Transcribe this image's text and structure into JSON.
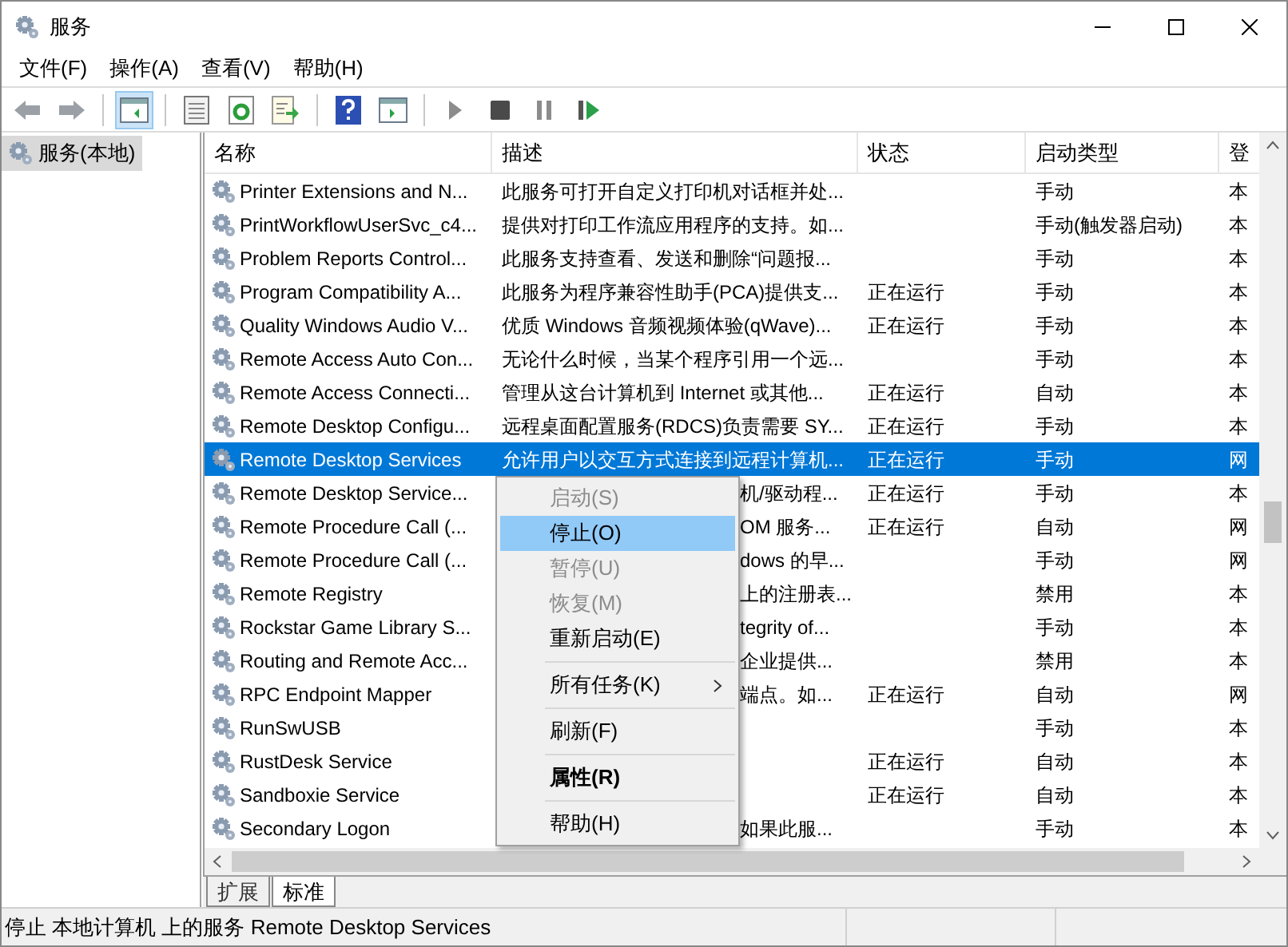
{
  "window": {
    "title": "服务"
  },
  "menubar": [
    "文件(F)",
    "操作(A)",
    "查看(V)",
    "帮助(H)"
  ],
  "tree": [
    {
      "label": "服务(本地)",
      "selected": true
    }
  ],
  "table": {
    "columns": [
      "名称",
      "描述",
      "状态",
      "启动类型",
      "登"
    ],
    "rows": [
      {
        "name": "Printer Extensions and N...",
        "description": "此服务可打开自定义打印机对话框并处...",
        "status": "",
        "startup": "手动",
        "logon": "本",
        "selected": false,
        "covered": false
      },
      {
        "name": "PrintWorkflowUserSvc_c4...",
        "description": "提供对打印工作流应用程序的支持。如...",
        "status": "",
        "startup": "手动(触发器启动)",
        "logon": "本",
        "selected": false,
        "covered": false
      },
      {
        "name": "Problem Reports Control...",
        "description": "此服务支持查看、发送和删除“问题报...",
        "status": "",
        "startup": "手动",
        "logon": "本",
        "selected": false,
        "covered": false
      },
      {
        "name": "Program Compatibility A...",
        "description": "此服务为程序兼容性助手(PCA)提供支...",
        "status": "正在运行",
        "startup": "手动",
        "logon": "本",
        "selected": false,
        "covered": false
      },
      {
        "name": "Quality Windows Audio V...",
        "description": "优质 Windows 音频视频体验(qWave)...",
        "status": "正在运行",
        "startup": "手动",
        "logon": "本",
        "selected": false,
        "covered": false
      },
      {
        "name": "Remote Access Auto Con...",
        "description": "无论什么时候，当某个程序引用一个远...",
        "status": "",
        "startup": "手动",
        "logon": "本",
        "selected": false,
        "covered": false
      },
      {
        "name": "Remote Access Connecti...",
        "description": "管理从这台计算机到 Internet 或其他...",
        "status": "正在运行",
        "startup": "自动",
        "logon": "本",
        "selected": false,
        "covered": false
      },
      {
        "name": "Remote Desktop Configu...",
        "description": "远程桌面配置服务(RDCS)负责需要 SY...",
        "status": "正在运行",
        "startup": "手动",
        "logon": "本",
        "selected": false,
        "covered": false
      },
      {
        "name": "Remote Desktop Services",
        "description": "允许用户以交互方式连接到远程计算机...",
        "status": "正在运行",
        "startup": "手动",
        "logon": "网",
        "selected": true,
        "covered": false
      },
      {
        "name": "Remote Desktop Service...",
        "description": "机/驱动程...",
        "status": "正在运行",
        "startup": "手动",
        "logon": "本",
        "selected": false,
        "covered": true
      },
      {
        "name": "Remote Procedure Call (...",
        "description": "OM 服务...",
        "status": "正在运行",
        "startup": "自动",
        "logon": "网",
        "selected": false,
        "covered": true
      },
      {
        "name": "Remote Procedure Call (...",
        "description": "dows 的早...",
        "status": "",
        "startup": "手动",
        "logon": "网",
        "selected": false,
        "covered": true
      },
      {
        "name": "Remote Registry",
        "description": "上的注册表...",
        "status": "",
        "startup": "禁用",
        "logon": "本",
        "selected": false,
        "covered": true
      },
      {
        "name": "Rockstar Game Library S...",
        "description": "tegrity of...",
        "status": "",
        "startup": "手动",
        "logon": "本",
        "selected": false,
        "covered": true
      },
      {
        "name": "Routing and Remote Acc...",
        "description": "企业提供...",
        "status": "",
        "startup": "禁用",
        "logon": "本",
        "selected": false,
        "covered": true
      },
      {
        "name": "RPC Endpoint Mapper",
        "description": "端点。如...",
        "status": "正在运行",
        "startup": "自动",
        "logon": "网",
        "selected": false,
        "covered": true
      },
      {
        "name": "RunSwUSB",
        "description": "",
        "status": "",
        "startup": "手动",
        "logon": "本",
        "selected": false
      },
      {
        "name": "RustDesk Service",
        "description": "",
        "status": "正在运行",
        "startup": "自动",
        "logon": "本",
        "selected": false
      },
      {
        "name": "Sandboxie Service",
        "description": "",
        "status": "正在运行",
        "startup": "自动",
        "logon": "本",
        "selected": false
      },
      {
        "name": "Secondary Logon",
        "description": "如果此服...",
        "status": "",
        "startup": "手动",
        "logon": "本",
        "selected": false,
        "covered": true
      }
    ]
  },
  "context_menu": [
    {
      "kind": "item",
      "label": "启动(S)",
      "disabled": true,
      "selected": false,
      "bold": false,
      "submenu": false
    },
    {
      "kind": "item",
      "label": "停止(O)",
      "disabled": false,
      "selected": true,
      "bold": false,
      "submenu": false
    },
    {
      "kind": "item",
      "label": "暂停(U)",
      "disabled": true,
      "selected": false,
      "bold": false,
      "submenu": false
    },
    {
      "kind": "item",
      "label": "恢复(M)",
      "disabled": true,
      "selected": false,
      "bold": false,
      "submenu": false
    },
    {
      "kind": "item",
      "label": "重新启动(E)",
      "disabled": false,
      "selected": false,
      "bold": false,
      "submenu": false
    },
    {
      "kind": "separator"
    },
    {
      "kind": "item",
      "label": "所有任务(K)",
      "disabled": false,
      "selected": false,
      "bold": false,
      "submenu": true
    },
    {
      "kind": "separator"
    },
    {
      "kind": "item",
      "label": "刷新(F)",
      "disabled": false,
      "selected": false,
      "bold": false,
      "submenu": false
    },
    {
      "kind": "separator"
    },
    {
      "kind": "item",
      "label": "属性(R)",
      "disabled": false,
      "selected": false,
      "bold": true,
      "submenu": false
    },
    {
      "kind": "separator"
    },
    {
      "kind": "item",
      "label": "帮助(H)",
      "disabled": false,
      "selected": false,
      "bold": false,
      "submenu": false
    }
  ],
  "tabs": [
    {
      "label": "扩展",
      "selected": false
    },
    {
      "label": "标准",
      "selected": true
    }
  ],
  "status_bar": "停止 本地计算机 上的服务 Remote Desktop Services"
}
